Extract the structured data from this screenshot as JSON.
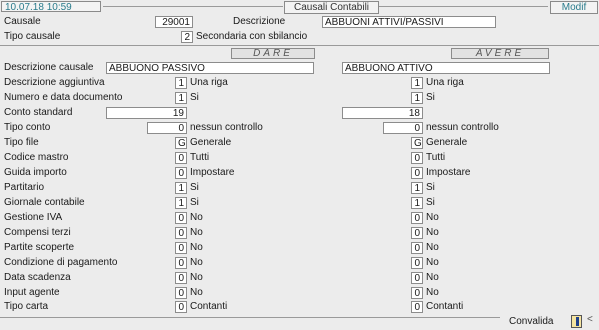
{
  "header": {
    "datetime": "10.07.18 10:59",
    "title": "Causali Contabili",
    "mode": "Modif"
  },
  "causale": {
    "label": "Causale",
    "value": "29001",
    "desc_label": "Descrizione",
    "desc_value": "ABBUONI ATTIVI/PASSIVI",
    "tipo_label": "Tipo causale",
    "tipo_value": "2",
    "tipo_desc": "Secondaria con sbilancio"
  },
  "sections": {
    "dare": "DARE",
    "avere": "AVERE"
  },
  "rows": [
    {
      "label": "Descrizione causale",
      "dare": {
        "value": "ABBUONO PASSIVO",
        "desc": ""
      },
      "avere": {
        "value": "ABBUONO ATTIVO",
        "desc": ""
      }
    },
    {
      "label": "Descrizione aggiuntiva",
      "dare": {
        "value": "1",
        "desc": "Una riga"
      },
      "avere": {
        "value": "1",
        "desc": "Una riga"
      }
    },
    {
      "label": "Numero e data documento",
      "dare": {
        "value": "1",
        "desc": "Si"
      },
      "avere": {
        "value": "1",
        "desc": "Si"
      }
    },
    {
      "label": "Conto standard",
      "dare": {
        "value": "19",
        "desc": ""
      },
      "avere": {
        "value": "18",
        "desc": ""
      }
    },
    {
      "label": "Tipo conto",
      "dare": {
        "value": "0",
        "desc": "nessun controllo"
      },
      "avere": {
        "value": "0",
        "desc": "nessun controllo"
      }
    },
    {
      "label": "Tipo file",
      "dare": {
        "value": "G",
        "desc": "Generale"
      },
      "avere": {
        "value": "G",
        "desc": "Generale"
      }
    },
    {
      "label": "Codice mastro",
      "dare": {
        "value": "0",
        "desc": "Tutti"
      },
      "avere": {
        "value": "0",
        "desc": "Tutti"
      }
    },
    {
      "label": "Guida importo",
      "dare": {
        "value": "0",
        "desc": "Impostare"
      },
      "avere": {
        "value": "0",
        "desc": "Impostare"
      }
    },
    {
      "label": "Partitario",
      "dare": {
        "value": "1",
        "desc": "Si"
      },
      "avere": {
        "value": "1",
        "desc": "Si"
      }
    },
    {
      "label": "Giornale contabile",
      "dare": {
        "value": "1",
        "desc": "Si"
      },
      "avere": {
        "value": "1",
        "desc": "Si"
      }
    },
    {
      "label": "Gestione IVA",
      "dare": {
        "value": "0",
        "desc": "No"
      },
      "avere": {
        "value": "0",
        "desc": "No"
      }
    },
    {
      "label": "Compensi terzi",
      "dare": {
        "value": "0",
        "desc": "No"
      },
      "avere": {
        "value": "0",
        "desc": "No"
      }
    },
    {
      "label": "Partite scoperte",
      "dare": {
        "value": "0",
        "desc": "No"
      },
      "avere": {
        "value": "0",
        "desc": "No"
      }
    },
    {
      "label": "Condizione di pagamento",
      "dare": {
        "value": "0",
        "desc": "No"
      },
      "avere": {
        "value": "0",
        "desc": "No"
      }
    },
    {
      "label": "Data scadenza",
      "dare": {
        "value": "0",
        "desc": "No"
      },
      "avere": {
        "value": "0",
        "desc": "No"
      }
    },
    {
      "label": "Input agente",
      "dare": {
        "value": "0",
        "desc": "No"
      },
      "avere": {
        "value": "0",
        "desc": "No"
      }
    },
    {
      "label": "Tipo carta",
      "dare": {
        "value": "0",
        "desc": "Contanti"
      },
      "avere": {
        "value": "0",
        "desc": "Contanti"
      }
    }
  ],
  "footer": {
    "convalida": "Convalida",
    "arrow": "<"
  }
}
